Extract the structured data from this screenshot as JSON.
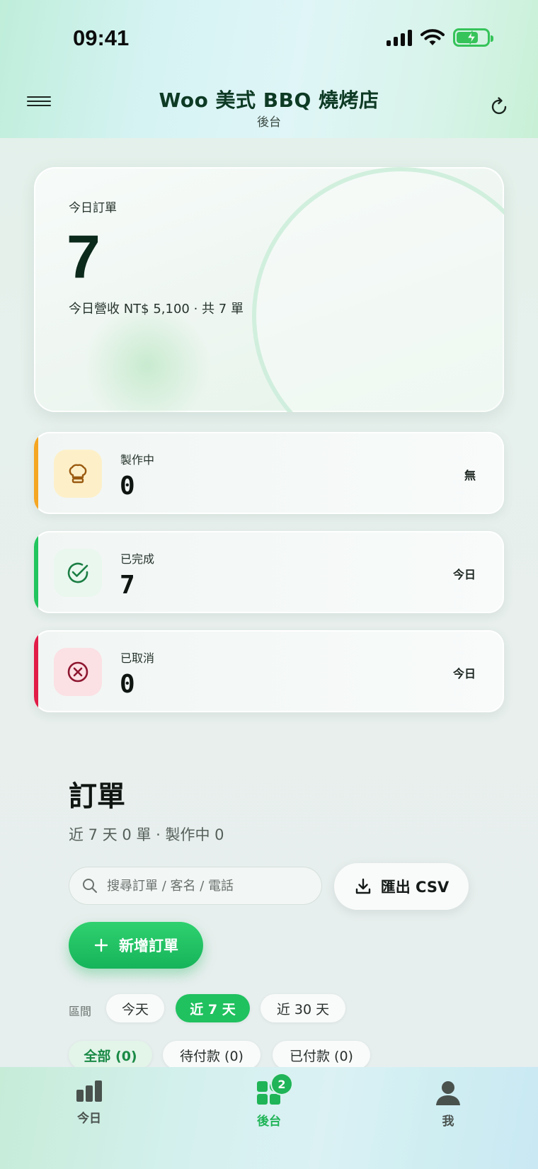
{
  "status_bar": {
    "time": "09:41"
  },
  "header": {
    "title": "Woo 美式 BBQ 燒烤店",
    "subtitle": "後台"
  },
  "hero": {
    "label": "今日訂單",
    "value": "7",
    "summary": "今日營收 NT$ 5,100 · 共 7 單"
  },
  "stats": [
    {
      "label": "製作中",
      "value": "0",
      "tag": "無",
      "accent": "#f5a623",
      "icon": "chef-hat-icon"
    },
    {
      "label": "已完成",
      "value": "7",
      "tag": "今日",
      "accent": "#22c55e",
      "icon": "check-circle-icon"
    },
    {
      "label": "已取消",
      "value": "0",
      "tag": "今日",
      "accent": "#e11d48",
      "icon": "x-circle-icon"
    }
  ],
  "orders": {
    "title": "訂單",
    "subtitle": "近 7 天 0 單 · 製作中 0",
    "search_placeholder": "搜尋訂單 / 客名 / 電話",
    "export_label": "匯出 CSV",
    "new_label": "新增訂單",
    "range_label": "區間",
    "ranges": [
      "今天",
      "近 7 天",
      "近 30 天"
    ],
    "selected_range": "近 7 天",
    "filters": [
      "全部 (0)",
      "待付款 (0)",
      "已付款 (0)"
    ],
    "selected_filter": "全部 (0)"
  },
  "tabbar": {
    "tabs": [
      {
        "label": "今日",
        "icon": "bar-chart-icon"
      },
      {
        "label": "後台",
        "icon": "dashboard-grid-icon",
        "badge": "2"
      },
      {
        "label": "我",
        "icon": "user-icon"
      }
    ],
    "active": "後台"
  },
  "colors": {
    "brand_green": "#1fb457",
    "title_green": "#0d3a24"
  }
}
